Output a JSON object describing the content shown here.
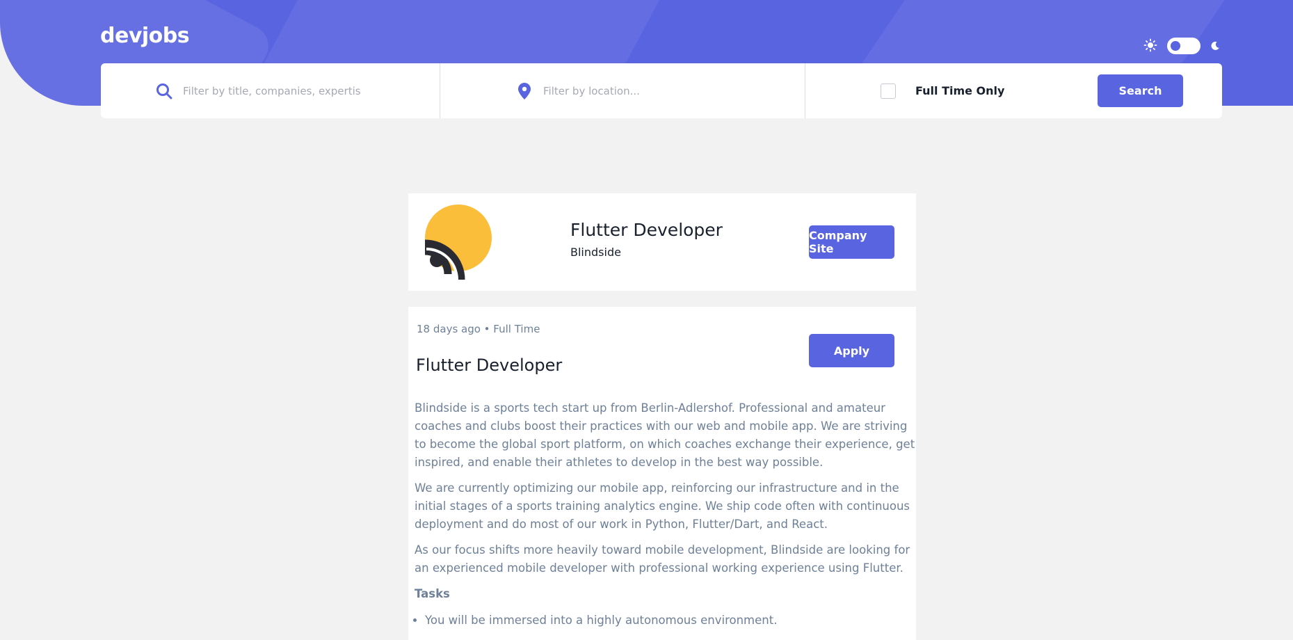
{
  "header": {
    "logo": "devjobs",
    "theme_toggle": {
      "light_icon": "sun-icon",
      "dark_icon": "moon-icon",
      "mode": "light"
    }
  },
  "search": {
    "title_placeholder": "Filter by title, companies, expertis",
    "title_value": "",
    "location_placeholder": "Filter by location...",
    "location_value": "",
    "full_time_label": "Full Time Only",
    "full_time_checked": false,
    "search_button": "Search"
  },
  "company": {
    "job_title": "Flutter Developer",
    "name": "Blindside",
    "site_button": "Company Site",
    "logo_colors": {
      "accent": "#fbbe3b",
      "dark": "#2a2a33"
    }
  },
  "job": {
    "meta": "18 days ago • Full Time",
    "title": "Flutter Developer",
    "apply_button": "Apply",
    "description": [
      "Blindside is a sports tech start up from Berlin-Adlershof. Professional and amateur coaches and clubs boost their practices with our web and mobile app. We are striving to become the global sport platform, on which coaches exchange their experience, get inspired, and enable their athletes to develop in the best way possible.",
      "We are currently optimizing our mobile app, reinforcing our infrastructure and in the initial stages of a sports training analytics engine. We ship code often with continuous deployment and do most of our work in Python, Flutter/Dart, and React.",
      "As our focus shifts more heavily toward mobile development, Blindside are looking for an experienced mobile developer with professional working experience using Flutter."
    ],
    "tasks_heading": "Tasks",
    "tasks": [
      "You will be immersed into a highly autonomous environment."
    ]
  },
  "colors": {
    "accent": "#5964e0",
    "background": "#f2f2f2",
    "text_dark": "#19202d",
    "text_gray": "#6e8098"
  }
}
